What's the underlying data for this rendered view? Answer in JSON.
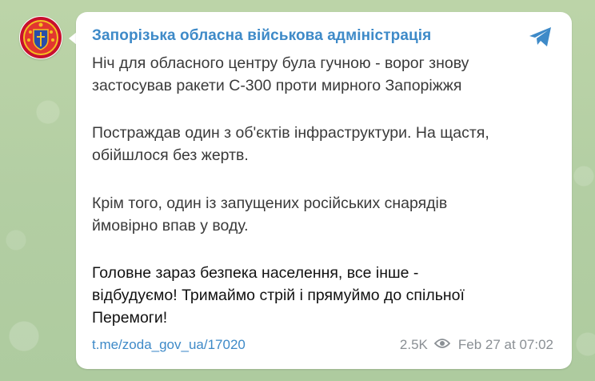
{
  "channel": {
    "name": "Запорізька обласна військова адміністрація",
    "avatar_icon": "coat-of-arms-icon",
    "platform_icon": "telegram-icon",
    "accent_color": "#3e8ac8"
  },
  "message": {
    "paragraphs": [
      {
        "lines": [
          "Ніч для обласного центру була гучною - ворог знову",
          "застосував ракети С-300 проти мирного Запоріжжя"
        ]
      },
      {
        "lines": [
          "Постраждав один з об'єктів інфраструктури. На щастя,",
          "обійшлося без жертв."
        ]
      },
      {
        "lines": [
          "Крім того, один із запущених російських снарядів",
          "ймовірно впав у воду."
        ]
      },
      {
        "lines": [
          "Головне зараз безпека населення, все інше -",
          "відбудуємо! Тримаймо стрій і прямуймо до спільної",
          "Перемоги!"
        ]
      }
    ],
    "link": "t.me/zoda_gov_ua/17020",
    "views": "2.5K",
    "views_icon": "eye-icon",
    "timestamp": "Feb 27 at 07:02"
  }
}
